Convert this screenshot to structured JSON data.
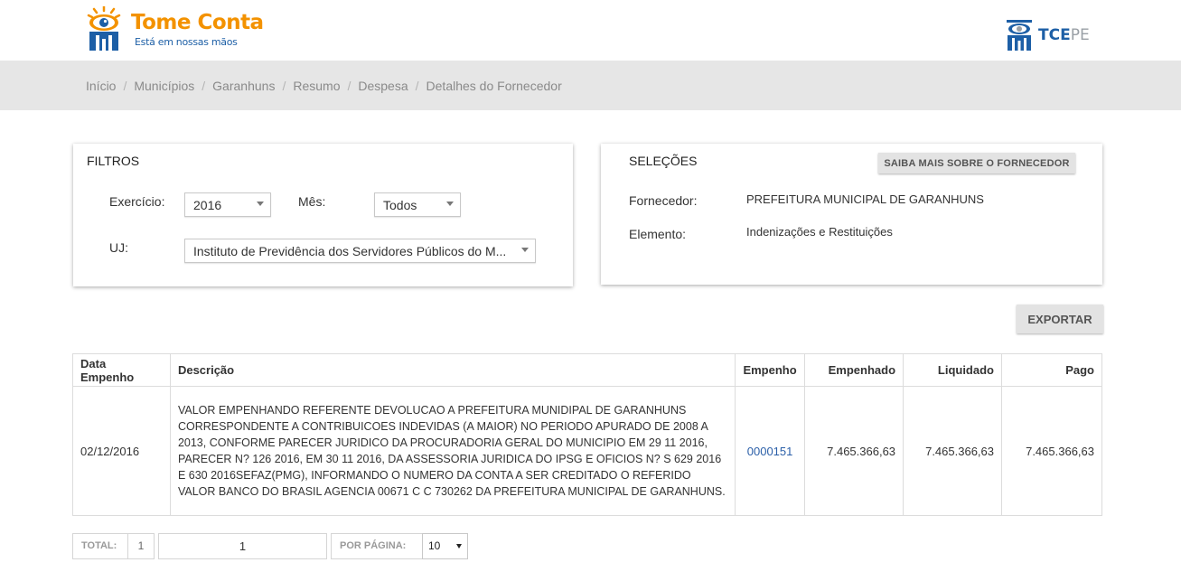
{
  "header": {
    "logo_title": "Tome Conta",
    "logo_subtitle": "Está em nossas mãos",
    "tce_brand_main": "TCE",
    "tce_brand_suffix": "PE",
    "brand_colors": {
      "orange": "#f39200",
      "blue": "#1d5fa6"
    }
  },
  "breadcrumb": [
    "Início",
    "Municípios",
    "Garanhuns",
    "Resumo",
    "Despesa",
    "Detalhes do Fornecedor"
  ],
  "filters": {
    "title": "FILTROS",
    "exercicio_label": "Exercício:",
    "exercicio_value": "2016",
    "mes_label": "Mês:",
    "mes_value": "Todos",
    "uj_label": "UJ:",
    "uj_value": "Instituto de Previdência dos Servidores Públicos do M..."
  },
  "selections": {
    "title": "SELEÇÕES",
    "saiba_button": "SAIBA MAIS SOBRE O FORNECEDOR",
    "fornecedor_label": "Fornecedor:",
    "fornecedor_value": "PREFEITURA MUNICIPAL DE GARANHUNS",
    "elemento_label": "Elemento:",
    "elemento_value": "Indenizações e Restituições"
  },
  "export_button": "EXPORTAR",
  "table": {
    "headers": [
      "Data Empenho",
      "Descrição",
      "Empenho",
      "Empenhado",
      "Liquidado",
      "Pago"
    ],
    "rows": [
      {
        "data": "02/12/2016",
        "descricao": "VALOR EMPENHANDO REFERENTE DEVOLUCAO A PREFEITURA MUNIDIPAL DE GARANHUNS CORRESPONDENTE A CONTRIBUICOES INDEVIDAS (A MAIOR) NO PERIODO APURADO DE 2008 A 2013, CONFORME PARECER JURIDICO DA PROCURADORIA GERAL DO MUNICIPIO EM 29 11 2016, PARECER N? 126 2016, EM 30 11 2016, DA ASSESSORIA JURIDICA DO IPSG E OFICIOS N? S 629 2016 E 630 2016SEFAZ(PMG), INFORMANDO O NUMERO DA CONTA A SER CREDITADO O REFERIDO VALOR BANCO DO BRASIL AGENCIA 00671 C C 730262 DA PREFEITURA MUNICIPAL DE GARANHUNS.",
        "empenho": "0000151",
        "empenhado": "7.465.366,63",
        "liquidado": "7.465.366,63",
        "pago": "7.465.366,63"
      }
    ]
  },
  "pagination": {
    "total_label": "TOTAL:",
    "total_value": "1",
    "page_value": "1",
    "per_page_label": "POR PÁGINA:",
    "per_page_value": "10"
  }
}
